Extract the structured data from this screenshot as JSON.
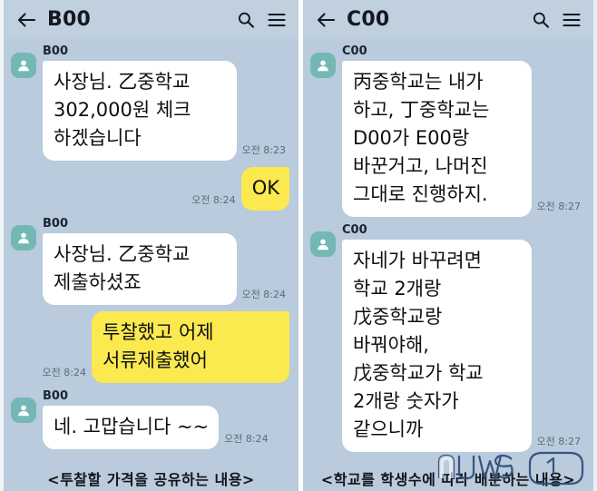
{
  "panels": [
    {
      "header": {
        "title": "B00",
        "back_icon": "arrow-left-icon",
        "search_icon": "search-icon",
        "menu_icon": "hamburger-menu-icon"
      },
      "messages": [
        {
          "direction": "in",
          "sender": "B00",
          "text": "사장님. 乙중학교 302,000원 체크 하겠습니다",
          "time": "오전 8:23"
        },
        {
          "direction": "out",
          "sender": "",
          "text": "OK",
          "time": "오전 8:24"
        },
        {
          "direction": "in",
          "sender": "B00",
          "text": "사장님. 乙중학교 제출하셨죠",
          "time": "오전 8:24"
        },
        {
          "direction": "out",
          "sender": "",
          "text": "투찰했고 어제 서류제출했어",
          "time": "오전 8:24"
        },
        {
          "direction": "in",
          "sender": "B00",
          "text": "네. 고맙습니다 ~~",
          "time": "오전 8:24"
        }
      ],
      "caption": "<투찰할 가격을 공유하는 내용>"
    },
    {
      "header": {
        "title": "C00",
        "back_icon": "arrow-left-icon",
        "search_icon": "search-icon",
        "menu_icon": "hamburger-menu-icon"
      },
      "messages": [
        {
          "direction": "in",
          "sender": "C00",
          "text": "丙중학교는 내가 하고, 丁중학교는 D00가 E00랑 바꾼거고, 나머진 그대로 진행하지.",
          "time": "오전 8:27"
        },
        {
          "direction": "in",
          "sender": "C00",
          "text": "자네가 바꾸려면 학교 2개랑 戊중학교랑 바꿔야해, 戊중학교가 학교 2개랑 숫자가 같으니까",
          "time": "오전 8:27"
        }
      ],
      "caption": "<학교를 학생수에 따라 배분하는 내용>"
    }
  ],
  "watermark": {
    "text": "news",
    "suffix": "1"
  },
  "colors": {
    "chat_background": "#b9cbdc",
    "header_background": "#c0d0de",
    "incoming_bubble": "#ffffff",
    "outgoing_bubble": "#fbe94f",
    "avatar": "#74b8b6",
    "timestamp_text": "#5e6b7a"
  }
}
